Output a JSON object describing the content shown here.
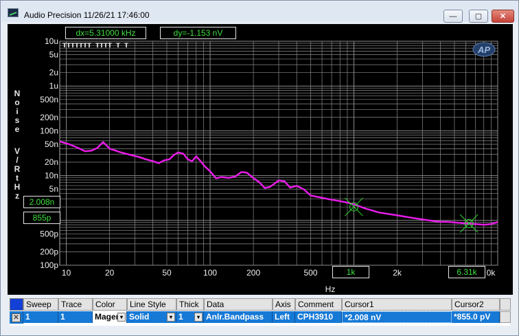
{
  "window": {
    "title": "Audio Precision  11/26/21 17:46:00",
    "min_glyph": "—",
    "max_glyph": "▢",
    "close_glyph": "✕"
  },
  "cursors": {
    "dx": "dx=5.31000 kHz",
    "dy": "dy=-1.153  nV",
    "cursor1_y": "2.008n",
    "cursor2_y": "855p",
    "cursor1_x": "1k",
    "cursor2_x": "6.31k"
  },
  "chart_data": {
    "type": "line",
    "ylabel": "Noise V/RtHz",
    "ylabel_chars": [
      "N",
      "o",
      "i",
      "s",
      "e",
      "",
      "V",
      "/",
      "R",
      "t",
      "H",
      "z"
    ],
    "xlabel": "Hz",
    "x_scale": "log",
    "y_scale": "log",
    "xlim": [
      9,
      10000
    ],
    "ylim": [
      1e-10,
      1e-05
    ],
    "grid": true,
    "x_ticks": [
      {
        "v": 10,
        "t": "10"
      },
      {
        "v": 20,
        "t": "20"
      },
      {
        "v": 50,
        "t": "50"
      },
      {
        "v": 100,
        "t": "100"
      },
      {
        "v": 200,
        "t": "200"
      },
      {
        "v": 500,
        "t": "500"
      },
      {
        "v": 2000,
        "t": "2k"
      },
      {
        "v": 10000,
        "t": "0k"
      }
    ],
    "y_ticks": [
      {
        "v": 1e-05,
        "t": "10u"
      },
      {
        "v": 5e-06,
        "t": "5u"
      },
      {
        "v": 2e-06,
        "t": "2u"
      },
      {
        "v": 1e-06,
        "t": "1u"
      },
      {
        "v": 5e-07,
        "t": "500n"
      },
      {
        "v": 2e-07,
        "t": "200n"
      },
      {
        "v": 1e-07,
        "t": "100n"
      },
      {
        "v": 5e-08,
        "t": "50n"
      },
      {
        "v": 2e-08,
        "t": "20n"
      },
      {
        "v": 1e-08,
        "t": "10n"
      },
      {
        "v": 5e-09,
        "t": "5n"
      },
      {
        "v": 5e-10,
        "t": "500p"
      },
      {
        "v": 2e-10,
        "t": "200p"
      },
      {
        "v": 1e-10,
        "t": "100p"
      }
    ],
    "series": [
      {
        "color": "#e81ce8",
        "x": [
          9,
          10.5,
          12,
          13.5,
          15,
          16.5,
          18,
          20,
          24,
          28,
          32,
          36,
          40,
          44,
          48,
          52,
          56,
          60,
          65,
          70,
          75,
          80,
          86,
          92,
          100,
          110,
          120,
          135,
          150,
          165,
          180,
          200,
          220,
          240,
          260,
          280,
          300,
          330,
          360,
          400,
          450,
          500,
          600,
          700,
          800,
          900,
          1000,
          1200,
          1500,
          2000,
          2500,
          3000,
          3500,
          4000,
          4500,
          5000,
          6000,
          6310,
          7000,
          8000,
          9000,
          10000
        ],
        "y": [
          5.8e-08,
          5e-08,
          4.2e-08,
          3.5e-08,
          3.6e-08,
          4.2e-08,
          5.6e-08,
          4e-08,
          3.3e-08,
          2.9e-08,
          2.6e-08,
          2.3e-08,
          2.1e-08,
          1.9e-08,
          2.2e-08,
          2.3e-08,
          2.9e-08,
          3.3e-08,
          3.1e-08,
          2.3e-08,
          2.1e-08,
          2.7e-08,
          2.1e-08,
          1.6e-08,
          1.25e-08,
          8.7e-09,
          9.3e-09,
          8.9e-09,
          9.6e-09,
          1.2e-08,
          1.17e-08,
          8.8e-09,
          7.1e-09,
          5.3e-09,
          5.6e-09,
          6.6e-09,
          7.8e-09,
          7.4e-09,
          5.4e-09,
          5.9e-09,
          4.9e-09,
          3.6e-09,
          3.2e-09,
          2.9e-09,
          2.7e-09,
          2.5e-09,
          2.3e-09,
          1.85e-09,
          1.5e-09,
          1.3e-09,
          1.15e-09,
          1.05e-09,
          9.8e-10,
          9.3e-10,
          9.3e-10,
          9e-10,
          8.6e-10,
          8.55e-10,
          8.3e-10,
          8e-10,
          8.3e-10,
          9.2e-10
        ]
      }
    ],
    "cursor_points": [
      {
        "x": 1000,
        "y": 2.008e-09
      },
      {
        "x": 6310,
        "y": 8.55e-10
      }
    ],
    "top_markers_text": "TTTTTTT TTTT T T"
  },
  "table": {
    "headers": [
      "Sweep",
      "Trace",
      "Color",
      "Line Style",
      "Thick",
      "Data",
      "Axis",
      "Comment",
      "Cursor1",
      "Cursor2"
    ],
    "row": {
      "delete_glyph": "✕",
      "sweep": "1",
      "trace": "1",
      "color": "Mager",
      "line_style": "Solid",
      "thick": "1",
      "data": "Anlr.Bandpass",
      "axis": "Left",
      "comment": "CPH3910",
      "cursor1": "*2.008  nV",
      "cursor2": "*855.0  pV"
    },
    "select_glyph": "▾"
  },
  "colors": {
    "trace": "#e81ce8",
    "grid": "#8c8c8c",
    "readout_text": "#3fe03f",
    "selection": "#1679d6"
  }
}
